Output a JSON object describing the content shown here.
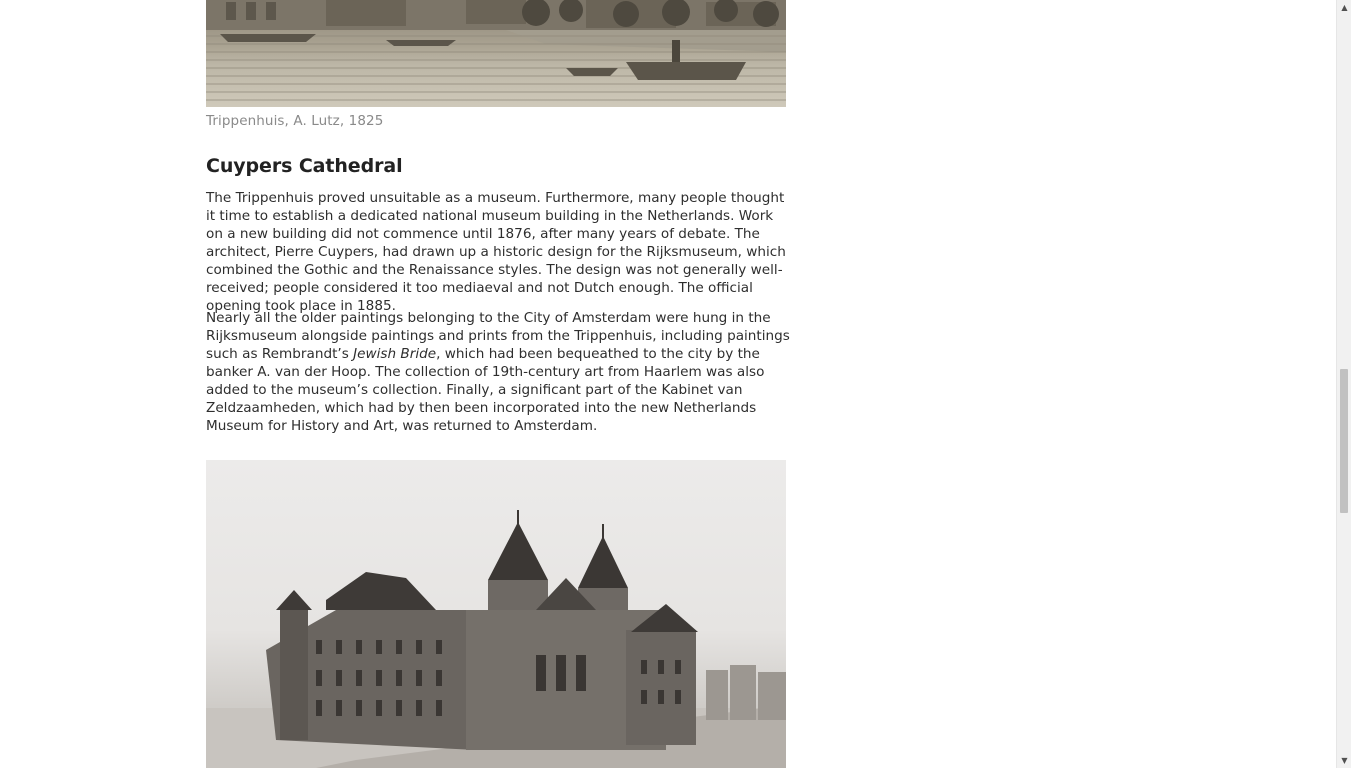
{
  "figures": {
    "top_caption": "Trippenhuis, A. Lutz, 1825",
    "top_image_name": "trippenhuis-etching",
    "bottom_image_name": "rijksmuseum-photograph"
  },
  "section": {
    "heading": "Cuypers Cathedral",
    "paragraph_1": "The Trippenhuis proved unsuitable as a museum. Furthermore, many people thought it time to establish a dedicated national museum building in the Netherlands. Work on a new building did not commence until 1876, after many years of debate. The architect, Pierre Cuypers, had drawn up a historic design for the Rijksmuseum, which combined the Gothic and the Renaissance styles. The design was not generally well-received; people considered it too mediaeval and not Dutch enough. The official opening took place in 1885.",
    "paragraph_2_before": "Nearly all the older paintings belonging to the City of Amsterdam were hung in the Rijksmuseum alongside paintings and prints from the Trippenhuis, including paintings such as Rembrandt’s ",
    "paragraph_2_italic": "Jewish Bride",
    "paragraph_2_after": ", which had been bequeathed to the city by the banker A. van der Hoop. The collection of 19th-century art from Haarlem was also added to the museum’s collection. Finally, a significant part of the Kabinet van Zeldzaamheden, which had by then been incorporated into the new Netherlands Museum for History and Art, was returned to Amsterdam."
  },
  "scrollbar": {
    "up_arrow": "▲",
    "down_arrow": "▼",
    "position_fraction": 0.5
  }
}
